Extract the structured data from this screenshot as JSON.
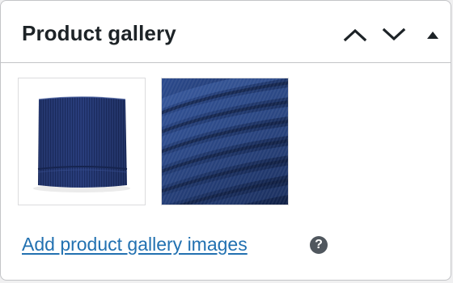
{
  "panel": {
    "title": "Product gallery",
    "controls": {
      "move_up_icon": "chevron-up-icon",
      "move_down_icon": "chevron-down-icon",
      "toggle_icon": "triangle-up-icon"
    }
  },
  "gallery": {
    "images": [
      {
        "subject": "folded navy ribbed knit scarf",
        "icon": "image-thumbnail"
      },
      {
        "subject": "navy ribbed knit fabric close-up",
        "icon": "image-thumbnail"
      }
    ],
    "add_link_label": "Add product gallery images",
    "help_icon_glyph": "?"
  },
  "colors": {
    "link": "#2271b1",
    "title": "#1d2327",
    "border": "#c3c4c7",
    "knit_navy": "#233a73",
    "help_icon_bg": "#50575e"
  }
}
